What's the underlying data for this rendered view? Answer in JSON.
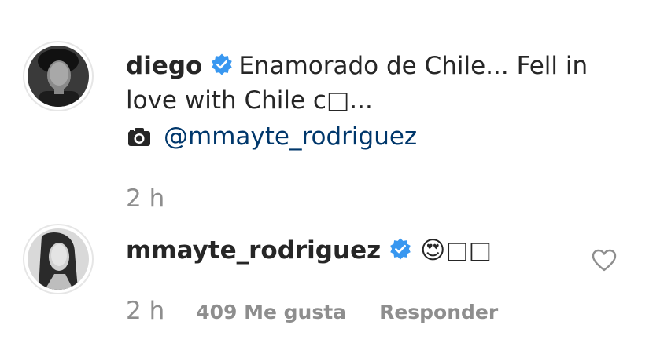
{
  "comments": [
    {
      "username": "diego",
      "text": "Enamorado de Chile... Fell in love with Chile c□...",
      "photo_credit": "@mmayte_rodriguez",
      "time": "2 h"
    },
    {
      "username": "mmayte_rodriguez",
      "text": "😍□□",
      "time": "2 h",
      "likes": "409 Me gusta",
      "reply": "Responder"
    }
  ],
  "icons": {
    "verified": "verified-badge-icon",
    "camera": "camera-icon",
    "heart": "heart-outline-icon"
  },
  "colors": {
    "verified": "#3897f0",
    "mention": "#00376b",
    "secondary_text": "#8e8e8e"
  }
}
